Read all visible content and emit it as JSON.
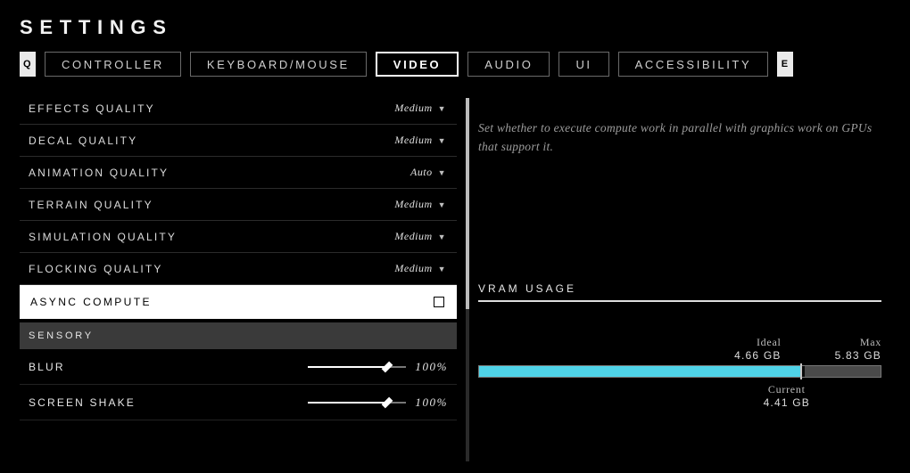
{
  "title": "SETTINGS",
  "bumpers": {
    "left": "Q",
    "right": "E"
  },
  "tabs": [
    {
      "label": "CONTROLLER",
      "active": false
    },
    {
      "label": "KEYBOARD/MOUSE",
      "active": false
    },
    {
      "label": "VIDEO",
      "active": true
    },
    {
      "label": "AUDIO",
      "active": false
    },
    {
      "label": "UI",
      "active": false
    },
    {
      "label": "ACCESSIBILITY",
      "active": false
    }
  ],
  "settings": {
    "quality_rows": [
      {
        "label": "EFFECTS QUALITY",
        "value": "Medium"
      },
      {
        "label": "DECAL QUALITY",
        "value": "Medium"
      },
      {
        "label": "ANIMATION QUALITY",
        "value": "Auto"
      },
      {
        "label": "TERRAIN QUALITY",
        "value": "Medium"
      },
      {
        "label": "SIMULATION QUALITY",
        "value": "Medium"
      },
      {
        "label": "FLOCKING QUALITY",
        "value": "Medium"
      }
    ],
    "selected": {
      "label": "ASYNC COMPUTE",
      "checked": false
    },
    "section": "SENSORY",
    "sliders": [
      {
        "label": "BLUR",
        "pct": "100%",
        "fill": 80
      },
      {
        "label": "SCREEN SHAKE",
        "pct": "100%",
        "fill": 80
      }
    ]
  },
  "description": "Set whether to execute compute work in parallel with graphics work on GPUs that support it.",
  "vram": {
    "title": "VRAM USAGE",
    "ideal_label": "Ideal",
    "ideal_value": "4.66 GB",
    "max_label": "Max",
    "max_value": "5.83 GB",
    "current_label": "Current",
    "current_value": "4.41 GB",
    "ideal_pct": 80,
    "current_pct": 76,
    "max_pct": 100
  }
}
